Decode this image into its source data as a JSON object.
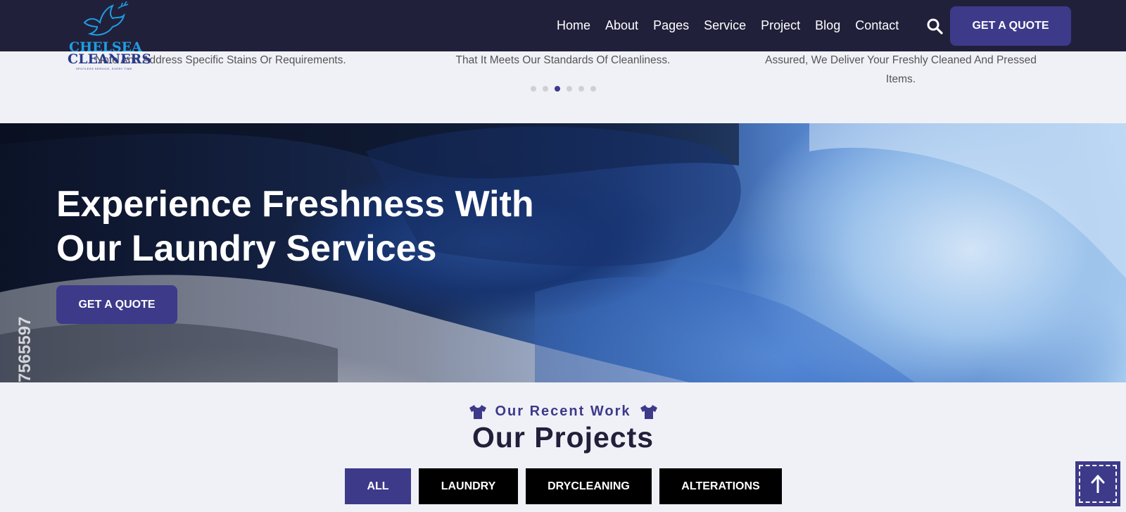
{
  "header": {
    "logo": {
      "line1": "CHELSEA",
      "line2": "CLEANERS",
      "tagline": "SPOTLESS SERVICE, EVERY TIME"
    },
    "nav": [
      "Home",
      "About",
      "Pages",
      "Service",
      "Project",
      "Blog",
      "Contact"
    ],
    "search_icon": "search-icon",
    "quote_label": "GET A QUOTE"
  },
  "steps": {
    "left": "Note And Address Specific Stains Or Requirements.",
    "middle": "That It Meets Our Standards Of Cleanliness.",
    "right": "Assured, We Deliver Your Freshly Cleaned And Pressed Items.",
    "dot_count": 6,
    "active_dot": 3
  },
  "hero": {
    "title_line1": "Experience Freshness With",
    "title_line2": "Our Laundry Services",
    "button_label": "GET A QUOTE",
    "watermark_id": "7565597"
  },
  "projects": {
    "kicker": "Our Recent Work",
    "kicker_icon": "tshirt-icon",
    "title": "Our Projects",
    "filters": [
      "ALL",
      "LAUNDRY",
      "DRYCLEANING",
      "ALTERATIONS"
    ],
    "active_filter": "ALL"
  },
  "scroll_top_icon": "arrow-up-icon",
  "colors": {
    "navy": "#21203b",
    "accent": "#3d3a8a",
    "background": "#f0f1f7"
  }
}
